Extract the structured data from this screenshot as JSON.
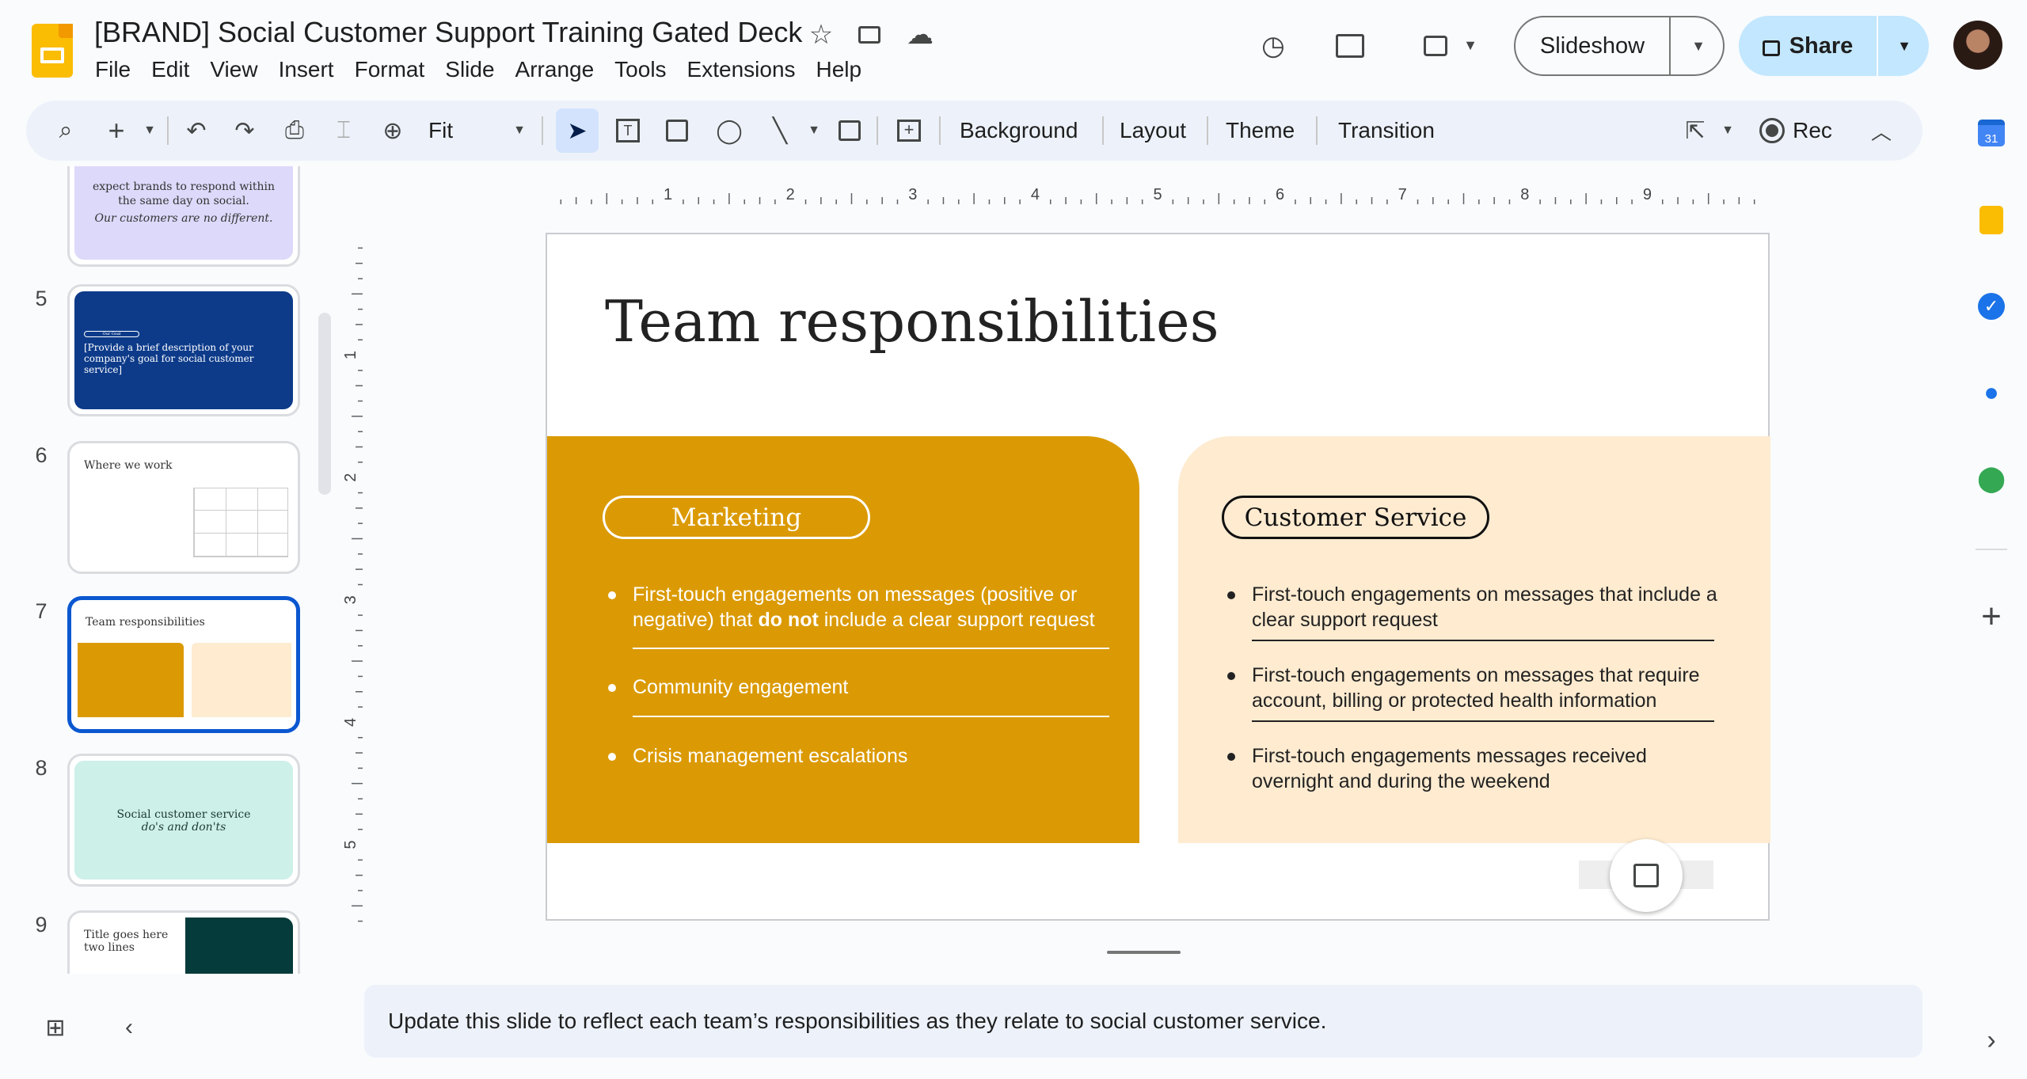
{
  "app": {
    "title": "[BRAND] Social Customer Support Training Gated Deck",
    "menu": [
      "File",
      "Edit",
      "View",
      "Insert",
      "Format",
      "Slide",
      "Arrange",
      "Tools",
      "Extensions",
      "Help"
    ],
    "slideshow_label": "Slideshow",
    "share_label": "Share"
  },
  "toolbar": {
    "zoom_value": "Fit",
    "background": "Background",
    "layout": "Layout",
    "theme": "Theme",
    "transition": "Transition",
    "rec": "Rec"
  },
  "filmstrip": [
    {
      "num": "",
      "text": [
        "expect brands to respond within",
        "the same day on social.",
        "Our customers are no different."
      ]
    },
    {
      "num": "5",
      "text": [
        "Our Goal",
        "[Provide a brief description of your",
        "company's goal for social customer service]"
      ]
    },
    {
      "num": "6",
      "text": [
        "Where we work"
      ]
    },
    {
      "num": "7",
      "text": [
        "Team responsibilities"
      ],
      "selected": true
    },
    {
      "num": "8",
      "text": [
        "Social customer service",
        "do's and don'ts"
      ]
    },
    {
      "num": "9",
      "text": [
        "Title goes here",
        "two lines"
      ]
    }
  ],
  "ruler": {
    "h": [
      "1",
      "2",
      "3",
      "4",
      "5",
      "6",
      "7",
      "8",
      "9"
    ],
    "v": [
      "1",
      "2",
      "3",
      "4",
      "5"
    ]
  },
  "slide": {
    "title": "Team responsibilities",
    "marketing": {
      "label": "Marketing",
      "color": "#DB9A04",
      "bullets": [
        {
          "pre": "First-touch engagements on messages (positive or negative) that ",
          "bold": "do not",
          "post": " include a clear support request"
        },
        {
          "pre": "Community engagement"
        },
        {
          "pre": "Crisis management escalations"
        }
      ]
    },
    "customer_service": {
      "label": "Customer Service",
      "color": "#FEEBD0",
      "bullets": [
        "First-touch engagements on messages that include a clear support request",
        "First-touch engagements on messages that require account, billing or protected health information",
        "First-touch engagements messages received overnight and during the weekend"
      ]
    }
  },
  "notes": "Update this slide to reflect each team’s responsibilities as they relate to social customer service.",
  "side_panel": [
    "calendar-icon",
    "keep-icon",
    "tasks-icon",
    "contacts-icon",
    "maps-icon",
    "add-icon"
  ]
}
